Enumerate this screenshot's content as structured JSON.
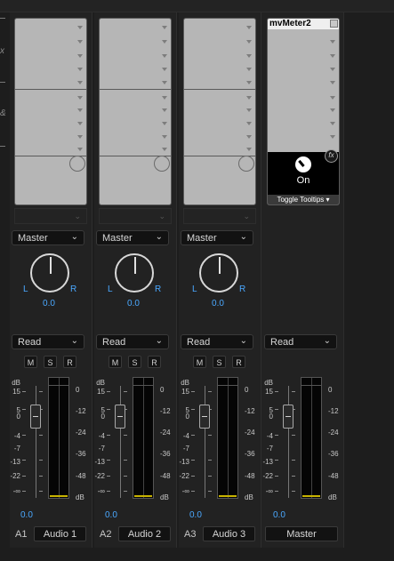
{
  "tracks": [
    {
      "id": "A1",
      "name": "Audio 1",
      "route": "Master",
      "automation": "Read",
      "pan": "0.0",
      "volume": "0.0"
    },
    {
      "id": "A2",
      "name": "Audio 2",
      "route": "Master",
      "automation": "Read",
      "pan": "0.0",
      "volume": "0.0"
    },
    {
      "id": "A3",
      "name": "Audio 3",
      "route": "Master",
      "automation": "Read",
      "pan": "0.0",
      "volume": "0.0"
    }
  ],
  "master": {
    "name": "Master",
    "automation": "Read",
    "volume": "0.0",
    "plugin": {
      "title": "mvMeter2",
      "state": "On",
      "tooltips_label": "Toggle Tooltips"
    }
  },
  "buttons": {
    "mute": "M",
    "solo": "S",
    "record": "R"
  },
  "pan_labels": {
    "left": "L",
    "right": "R"
  },
  "fader_scale": [
    "dB",
    "15",
    "5",
    "0",
    "-4",
    "-7",
    "-13",
    "-22",
    "-∞"
  ],
  "meter_scale": [
    "0",
    "-12",
    "-24",
    "-36",
    "-48",
    "dB"
  ],
  "icons": {
    "fx": "fx-icon",
    "chevron": "chevron-down-icon"
  }
}
